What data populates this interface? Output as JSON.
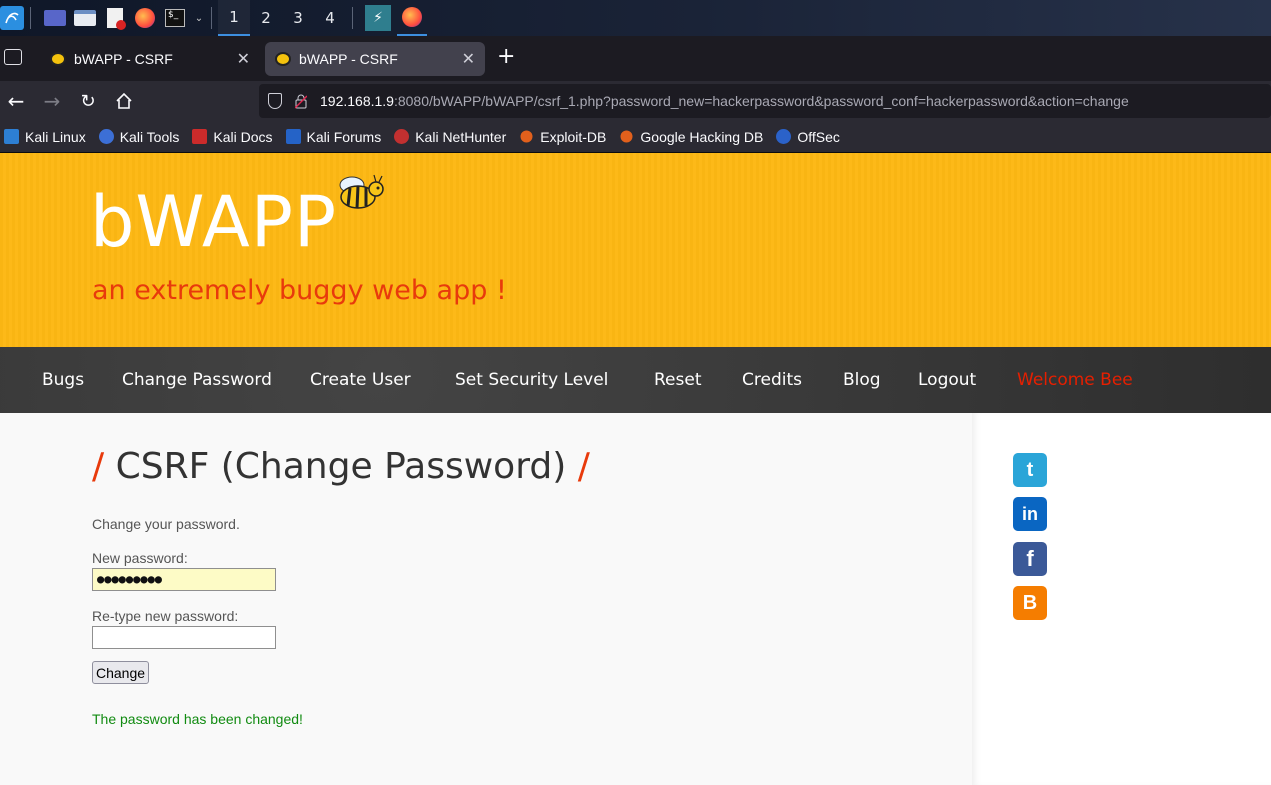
{
  "taskbar": {
    "workspaces": [
      "1",
      "2",
      "3",
      "4"
    ],
    "active_workspace": "1"
  },
  "tabs": [
    {
      "title": "bWAPP - CSRF",
      "active": false
    },
    {
      "title": "bWAPP - CSRF",
      "active": true
    }
  ],
  "url": {
    "host": "192.168.1.9",
    "rest": ":8080/bWAPP/bWAPP/csrf_1.php?password_new=hackerpassword&password_conf=hackerpassword&action=change"
  },
  "bookmarks": [
    {
      "label": "Kali Linux",
      "color": "#2d7fd4"
    },
    {
      "label": "Kali Tools",
      "color": "#3c6fd6"
    },
    {
      "label": "Kali Docs",
      "color": "#cc2b2b"
    },
    {
      "label": "Kali Forums",
      "color": "#2563c7"
    },
    {
      "label": "Kali NetHunter",
      "color": "#c23030"
    },
    {
      "label": "Exploit-DB",
      "color": "#e2601c"
    },
    {
      "label": "Google Hacking DB",
      "color": "#e2601c"
    },
    {
      "label": "OffSec",
      "color": "#2b62c9"
    }
  ],
  "header": {
    "logo": "bWAPP",
    "tagline": "an extremely buggy web app !"
  },
  "menu": {
    "items": [
      "Bugs",
      "Change Password",
      "Create User",
      "Set Security Level",
      "Reset",
      "Credits",
      "Blog",
      "Logout"
    ],
    "welcome": "Welcome Bee"
  },
  "content": {
    "title": "CSRF (Change Password)",
    "slash": "/",
    "intro": "Change your password.",
    "new_password_label": "New password:",
    "new_password_value": "●●●●●●●●●",
    "retype_label": "Re-type new password:",
    "retype_value": "",
    "button": "Change",
    "message": "The password has been changed!"
  },
  "social": [
    {
      "icon": "twitter-icon",
      "glyph": "t",
      "color": "#2aa5d8"
    },
    {
      "icon": "linkedin-icon",
      "glyph": "in",
      "color": "#0a66c2"
    },
    {
      "icon": "facebook-icon",
      "glyph": "f",
      "color": "#3b5998"
    },
    {
      "icon": "blogger-icon",
      "glyph": "B",
      "color": "#f57d00"
    }
  ],
  "colors": {
    "header_bg": "#fdb813",
    "tagline": "#e83a0c",
    "menu_bg": "#3a3a3a",
    "welcome": "#e61f00",
    "success": "#118b11"
  }
}
